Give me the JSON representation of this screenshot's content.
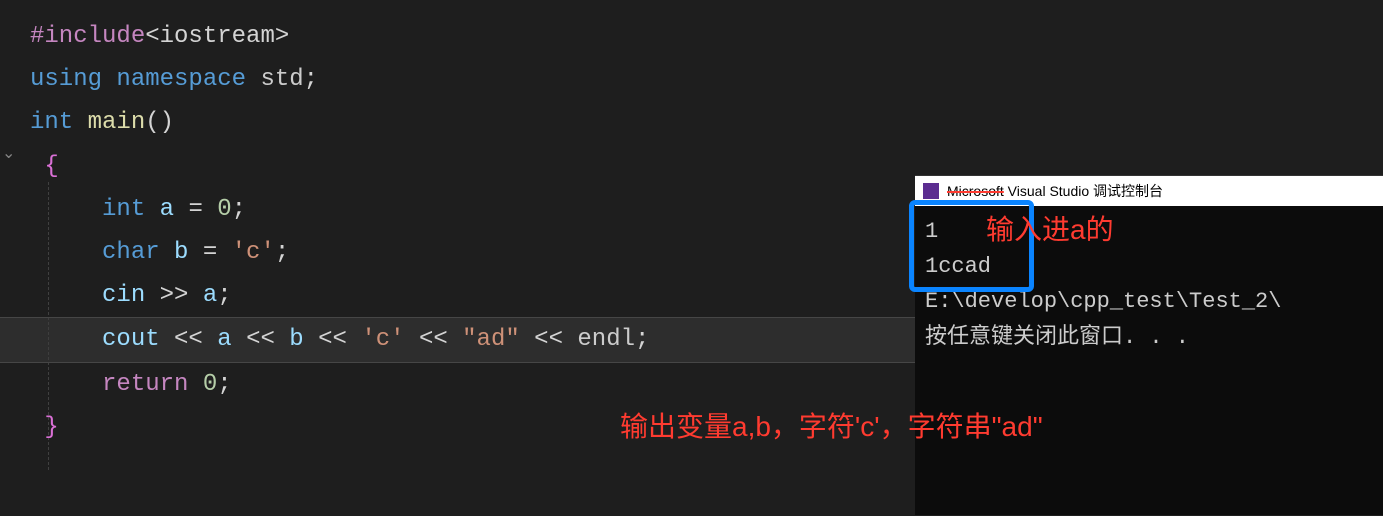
{
  "code": {
    "l1_a": "#include",
    "l1_b": "<iostream>",
    "l2_a": "using",
    "l2_b": "namespace",
    "l2_c": "std",
    "l2_d": ";",
    "l3_a": "int",
    "l3_b": "main",
    "l3_c": "()",
    "l4": "{",
    "l5_a": "int",
    "l5_b": "a",
    "l5_c": "=",
    "l5_d": "0",
    "l5_e": ";",
    "l6_a": "char",
    "l6_b": "b",
    "l6_c": "=",
    "l6_d": "'c'",
    "l6_e": ";",
    "l7_a": "cin",
    "l7_b": ">>",
    "l7_c": "a",
    "l7_d": ";",
    "l8_a": "cout",
    "l8_b": "<<",
    "l8_c": "a",
    "l8_d": "<<",
    "l8_e": "b",
    "l8_f": "<<",
    "l8_g": "'c'",
    "l8_h": "<<",
    "l8_i": "\"ad\"",
    "l8_j": "<<",
    "l8_k": "endl",
    "l8_l": ";",
    "l9_a": "return",
    "l9_b": "0",
    "l9_c": ";",
    "l10": "}"
  },
  "fold": "⌄",
  "console": {
    "title_prefix": "Microsoft",
    "title_suffix": " Visual Studio 调试控制台",
    "line1": "1",
    "line2": "1ccad",
    "line3": "",
    "line4": "E:\\develop\\cpp_test\\Test_2\\",
    "line5": "按任意键关闭此窗口. . ."
  },
  "annotations": {
    "red1": "输入进a的",
    "red2": "输出变量a,b，字符'c'，字符串\"ad\""
  }
}
